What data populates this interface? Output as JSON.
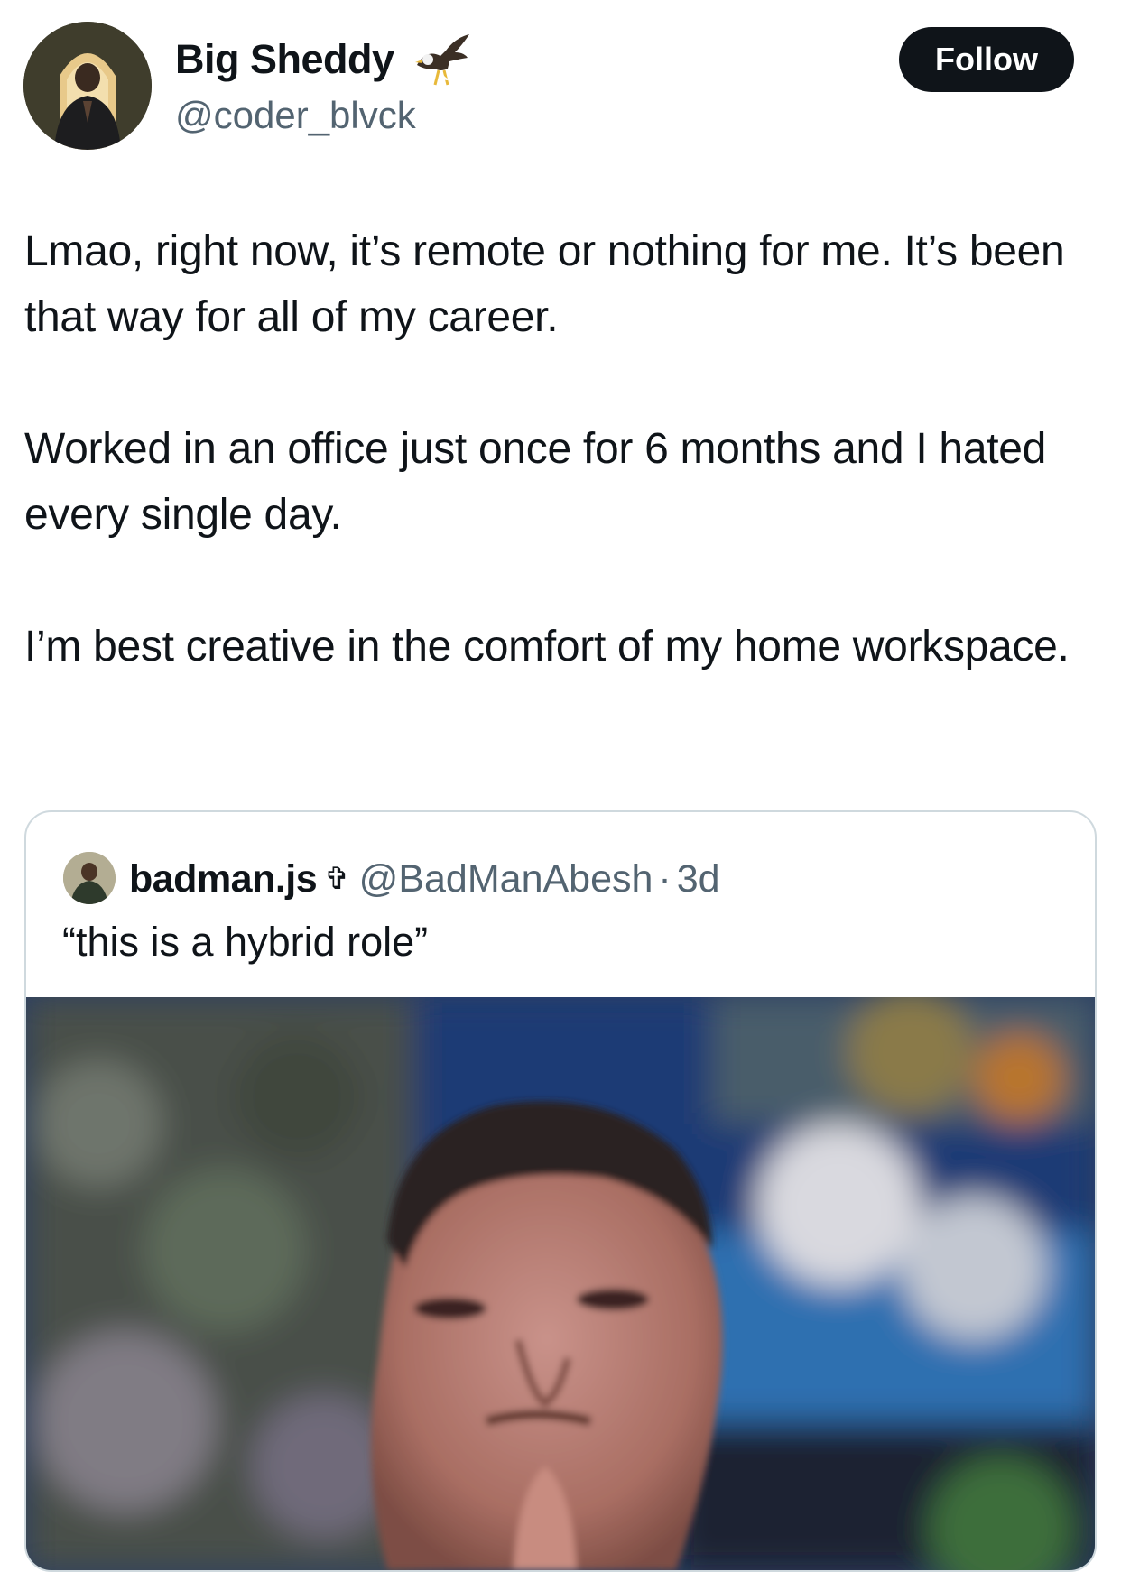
{
  "tweet": {
    "author": {
      "display_name": "Big Sheddy",
      "badge_icon": "eagle-icon",
      "handle": "@coder_blvck"
    },
    "follow_label": "Follow",
    "paragraphs": [
      "Lmao, right now, it’s remote or nothing for me. It’s been that way for all of my career.",
      "Worked in an office just once for 6 months and I hated every single day.",
      "I’m best creative in the comfort of my home workspace."
    ]
  },
  "quote": {
    "display_name": "badman.js",
    "emoji": "✞",
    "handle": "@BadManAbesh",
    "separator": "·",
    "time": "3d",
    "text": "“this is a hybrid role”",
    "media_icon": "reaction-gif-image"
  },
  "colors": {
    "text_primary": "#0f1419",
    "text_secondary": "#536471",
    "border": "#cfd9de",
    "follow_bg": "#0f1419"
  }
}
